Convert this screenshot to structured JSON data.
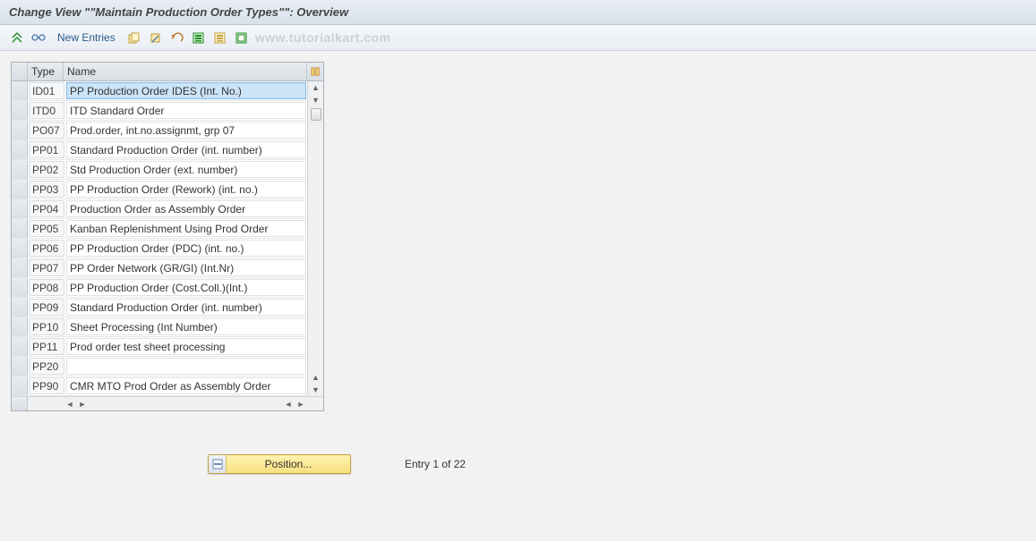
{
  "title": "Change View \"\"Maintain Production Order Types\"\": Overview",
  "toolbar": {
    "new_entries": "New Entries",
    "watermark": "www.tutorialkart.com"
  },
  "table": {
    "header_type": "Type",
    "header_name": "Name",
    "rows": [
      {
        "type": "ID01",
        "name": "PP Production Order IDES    (Int. No.)",
        "selected": true
      },
      {
        "type": "ITD0",
        "name": "ITD Standard Order"
      },
      {
        "type": "PO07",
        "name": "Prod.order, int.no.assignmt, grp 07"
      },
      {
        "type": "PP01",
        "name": "Standard Production Order (int. number)"
      },
      {
        "type": "PP02",
        "name": "Std Production Order (ext. number)"
      },
      {
        "type": "PP03",
        "name": "PP Production Order (Rework)  (int. no.)"
      },
      {
        "type": "PP04",
        "name": "Production Order as Assembly Order"
      },
      {
        "type": "PP05",
        "name": "Kanban Replenishment Using Prod Order"
      },
      {
        "type": "PP06",
        "name": "PP Production Order (PDC)    (int. no.)"
      },
      {
        "type": "PP07",
        "name": "PP Order Network    (GR/GI)  (Int.Nr)"
      },
      {
        "type": "PP08",
        "name": "PP Production Order  (Cost.Coll.)(Int.)"
      },
      {
        "type": "PP09",
        "name": "Standard Production Order (int. number)"
      },
      {
        "type": "PP10",
        "name": "Sheet Processing (Int Number)"
      },
      {
        "type": "PP11",
        "name": "Prod order test sheet processing"
      },
      {
        "type": "PP20",
        "name": ""
      },
      {
        "type": "PP90",
        "name": "CMR MTO Prod Order as Assembly Order"
      }
    ]
  },
  "footer": {
    "position_label": "Position...",
    "entry_text": "Entry 1 of 22"
  }
}
